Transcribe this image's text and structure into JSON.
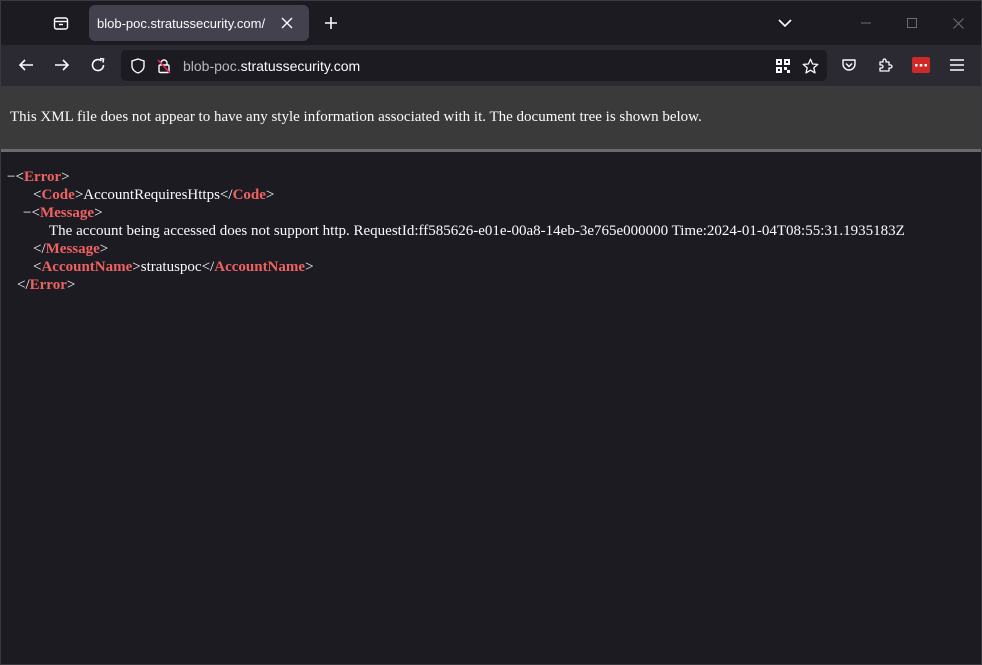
{
  "tab": {
    "title": "blob-poc.stratussecurity.com/"
  },
  "urlbar": {
    "host": "blob-poc.",
    "domain": "stratussecurity.com"
  },
  "xml": {
    "notice": "This XML file does not appear to have any style information associated with it. The document tree is shown below.",
    "fold_marker": "−",
    "open_bracket": "<",
    "close_bracket": ">",
    "end_open_bracket": "</",
    "tags": {
      "error": "Error",
      "code": "Code",
      "message": "Message",
      "account_name": "AccountName"
    },
    "values": {
      "code": "AccountRequiresHttps",
      "message": "The account being accessed does not support http. RequestId:ff585626-e01e-00a8-14eb-3e765e000000 Time:2024-01-04T08:55:31.1935183Z",
      "account_name": "stratuspoc"
    }
  },
  "colors": {
    "tag": "#ef6262",
    "background": "#1c1b22",
    "toolbar": "#2b2a33",
    "header": "#3a3a3a"
  },
  "icons": {
    "tab_list": "tab-list-icon",
    "close": "close-icon",
    "new_tab": "plus-icon",
    "overflow": "chevron-down-icon",
    "back": "back-arrow-icon",
    "forward": "forward-arrow-icon",
    "reload": "reload-icon",
    "shield": "shield-icon",
    "lock": "insecure-lock-icon",
    "qr": "qr-code-icon",
    "bookmark": "star-icon",
    "pocket": "pocket-icon",
    "extensions": "puzzle-icon",
    "addon": "password-manager-icon",
    "menu": "hamburger-menu-icon"
  }
}
